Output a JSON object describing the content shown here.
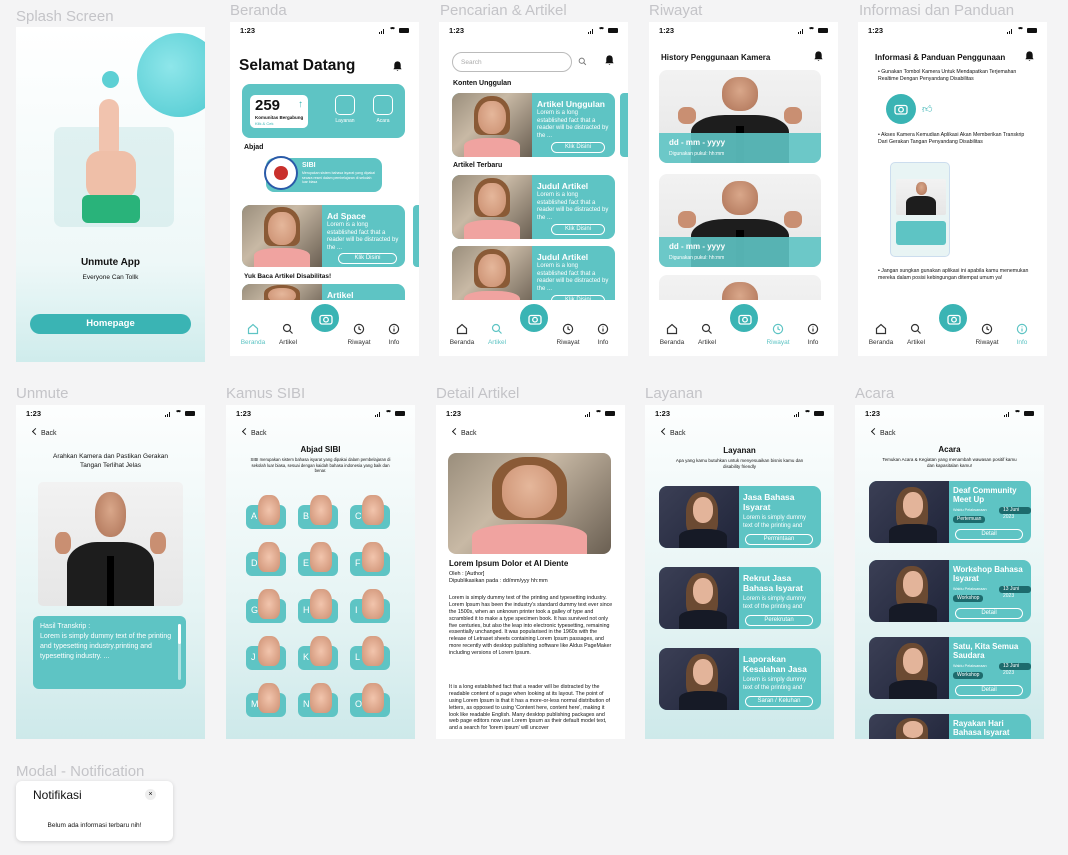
{
  "labels": {
    "splash": "Splash Screen",
    "beranda": "Beranda",
    "pencarian": "Pencarian & Artikel",
    "riwayat": "Riwayat",
    "info": "Informasi dan Panduan",
    "unmute": "Unmute",
    "kamus": "Kamus SIBI",
    "detail": "Detail Artikel",
    "layanan": "Layanan",
    "acara": "Acara",
    "modal": "Modal - Notification"
  },
  "time": "1:23",
  "splash": {
    "app": "Unmute App",
    "tagline": "Everyone Can Tollk",
    "button": "Homepage"
  },
  "nav": {
    "beranda": "Beranda",
    "artikel": "Artikel",
    "riwayat": "Riwayat",
    "info": "Info"
  },
  "beranda": {
    "title": "Selamat Datang",
    "count": "259",
    "count_label": "Komunitas Bergabung",
    "count_sub": "Klik & Cek",
    "layanan": "Layanan",
    "acara": "Acara",
    "abjad": "Abjad",
    "sibi_title": "SIBI",
    "sibi_text": "Merupakan sistem bahasa isyarat yang dipakai secara resmi dalam pembelajaran di sekolah luar biasa",
    "ad_title": "Ad Space",
    "ad_text": "Lorem is a long established fact that a reader will be distracted by the ...",
    "ad_btn": "Klik Disini",
    "yuk": "Yuk Baca Artikel Disabilitas!",
    "art": "Artikel"
  },
  "pencarian": {
    "search": "Search",
    "unggulan": "Konten Unggulan",
    "terbaru": "Artikel Terbaru",
    "a1_title": "Artikel Unggulan",
    "a_text": "Lorem is a long established fact that a reader will be distracted by the ...",
    "btn": "Klik Disini",
    "judul": "Judul Artikel"
  },
  "riwayat": {
    "title": "History Penggunaan Kamera",
    "date": "dd - mm - yyyy",
    "sub": "Digunakan pukul: hh:mm"
  },
  "info": {
    "title": "Informasi & Panduan Penggunaan",
    "b1": "Gunakan Tombol Kamera Untuk Mendapatkan Terjemahan Realtime Dengan Penyandang Disabilitas",
    "b2": "Akses Kamera Kemudian Aplikasi Akan Memberikan Transkrip Dari Gerakan Tangan Penyandang Disabilitas",
    "b3": "Jangan sungkan gunakan aplikasi ini apabila kamu menemukan mereka dalam posisi kebingungan ditempat umum ya!"
  },
  "back": "Back",
  "unmute": {
    "instr": "Arahkan Kamera dan Pastikan Gerakan Tangan Terlihat Jelas",
    "hasil": "Hasil Transkrip :",
    "text": "Lorem is simply dummy text of the printing and typesetting industry.printing and typesetting industry. ..."
  },
  "kamus": {
    "title": "Abjad SIBI",
    "desc": "SIBI merupakan sistem bahasa isyarat yang dipakai dalam pembelajaran di sekolah luar biasa, sesuai dengan kaidah bahasa indonesia yang baik dan benar.",
    "letters": [
      "A",
      "B",
      "C",
      "D",
      "E",
      "F",
      "G",
      "H",
      "I",
      "J",
      "K",
      "L",
      "M",
      "N",
      "O"
    ]
  },
  "detail": {
    "title": "Lorem Ipsum Dolor et Al Diente",
    "author": "Oleh : [Author]",
    "pub": "Dipublikasikan pada : dd/mm/yyy hh:mm",
    "p1": "Lorem is simply dummy text of the printing and typesetting industry. Lorem Ipsum has been the industry's standard dummy text ever since the 1500s, when an unknown printer took a galley of type and scrambled it to make a type specimen book. It has survived not only five centuries, but also the leap into electronic typesetting, remaining essentially unchanged. It was popularised in the 1960s with the release of Letraset sheets containing Lorem Ipsum passages, and more recently with desktop publishing software like Aldus PageMaker including versions of Lorem Ipsum.",
    "p2": "It is a long established fact that a reader will be distracted by the readable content of a page when looking at its layout. The point of using Lorem Ipsum is that it has a more-or-less normal distribution of letters, as opposed to using 'Content here, content here', making it look like readable English. Many desktop publishing packages and web page editors now use Lorem Ipsum as their default model text, and a search for 'lorem ipsum' will uncover"
  },
  "layanan": {
    "title": "Layanan",
    "desc": "Apa yang kamu butuhkan untuk menyesuaikan bisnis kamu dan disability friendly",
    "items": [
      {
        "t": "Jasa Bahasa Isyarat",
        "b": "Permintaan"
      },
      {
        "t": "Rekrut Jasa Bahasa Isyarat",
        "b": "Perekrutan"
      },
      {
        "t": "Laporakan Kesalahan Jasa",
        "b": "Saran / Keluhan"
      }
    ],
    "text": "Lorem is simply dummy text of the printing and"
  },
  "acara": {
    "title": "Acara",
    "desc": "Temukan Acara & Kegiatan yang menambah wawasan positif kamu dan kapasitalan kamu!",
    "items": [
      {
        "t": "Deaf Community Meet Up",
        "tag": "Pertemuan",
        "date": "13 Juni 2023"
      },
      {
        "t": "Workshop Bahasa Isyarat",
        "tag": "Workshop",
        "date": "13 Juni 2023"
      },
      {
        "t": "Satu, Kita Semua Saudara",
        "tag": "Workshop",
        "date": "13 Juni 2023"
      },
      {
        "t": "Rayakan Hari Bahasa Isyarat",
        "tag": "",
        "date": ""
      }
    ],
    "waktu": "Waktu Pelaksanaan",
    "detail": "Detail"
  },
  "modal": {
    "title": "Notifikasi",
    "text": "Belum ada informasi terbaru nih!"
  }
}
